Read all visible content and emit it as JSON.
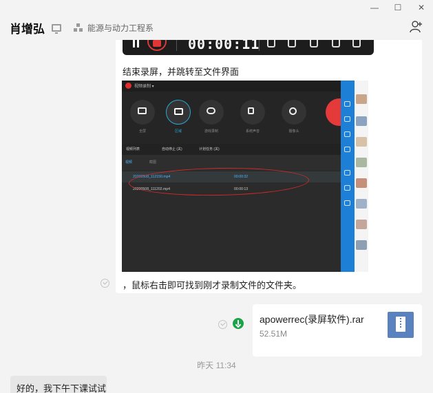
{
  "window": {
    "controls": [
      "minimize",
      "maximize",
      "close"
    ]
  },
  "header": {
    "contact_name": "肖增弘",
    "department": "能源与动力工程系"
  },
  "recorder_toolbar": {
    "timer": "00:00:11"
  },
  "messages": {
    "caption_end": "结束录屏，并跳转至文件界面",
    "caption_folder": "，鼠标右击即可找到刚才录制文件的文件夹。",
    "file": {
      "name": "apowerrec(录屏软件).rar",
      "size": "52.51M"
    },
    "timestamp": "昨天 11:34",
    "reply": "好的，我下午下课试试"
  },
  "screenshot": {
    "app_title": "视频录制 ▾",
    "tools": [
      "全屏",
      "区域",
      "游戏录制",
      "系统声音",
      "摄像头"
    ],
    "tabs": [
      "视频列表",
      "自动停止 (关)",
      "计划任务 (关)"
    ],
    "subtabs": [
      "视频",
      "截图"
    ],
    "recordings": [
      {
        "file": "20200508_112150.mp4",
        "duration": "00:00:32"
      },
      {
        "file": "20200508_111202.mp4",
        "duration": "00:00:13"
      }
    ]
  },
  "colors": {
    "accent_blue": "#1e7fd6",
    "record_red": "#e43a3a",
    "download_green": "#1ba34a",
    "file_icon": "#5a82bf"
  }
}
